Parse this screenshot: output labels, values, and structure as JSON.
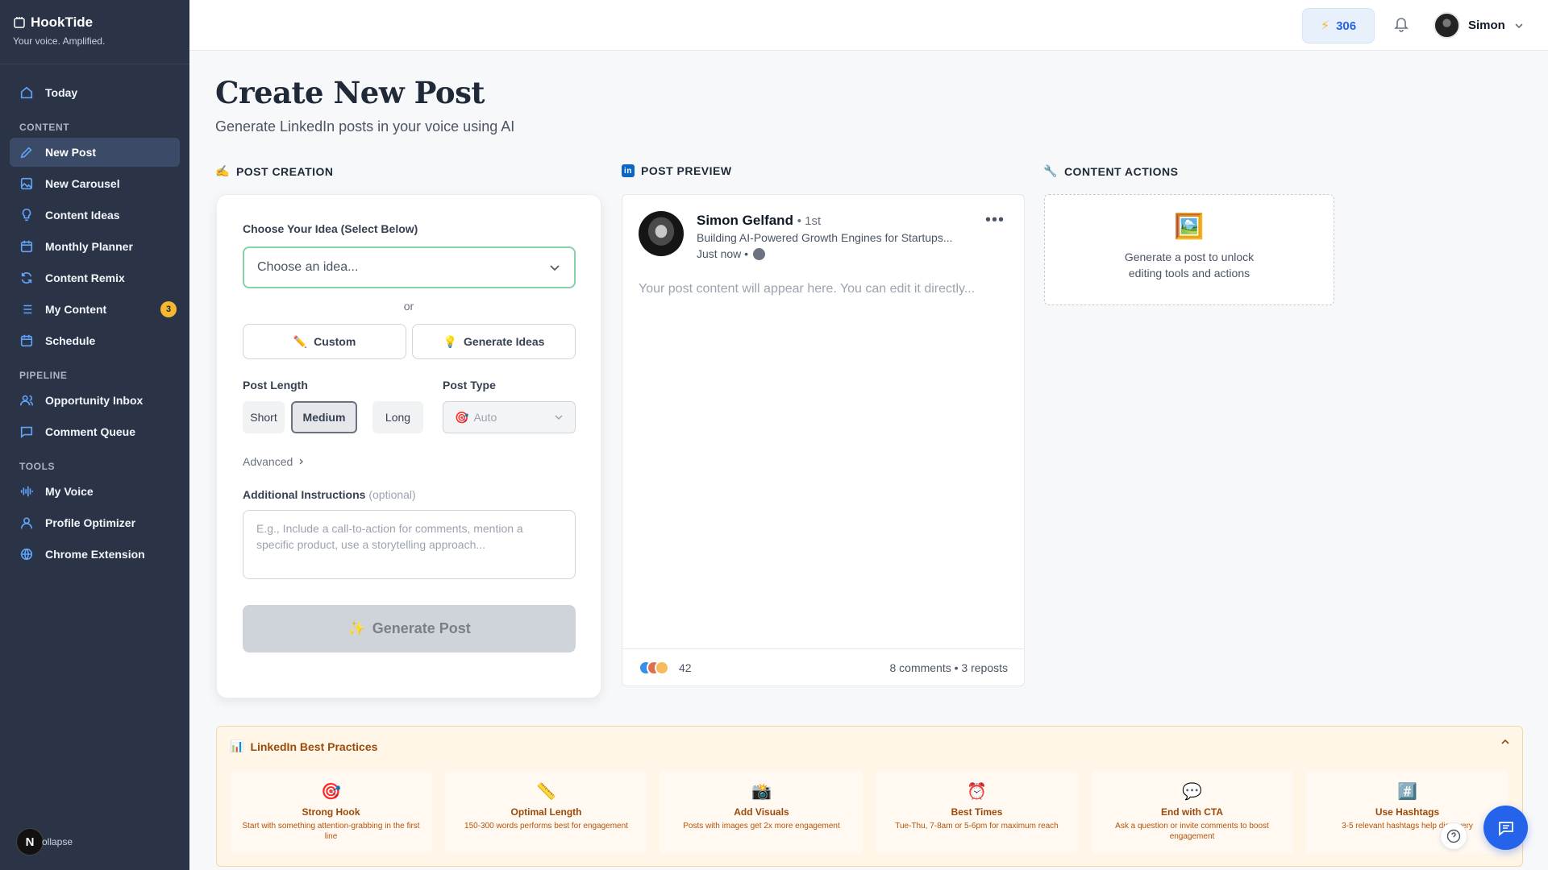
{
  "brand": {
    "name": "HookTide",
    "tagline": "Your voice. Amplified."
  },
  "sidebar": {
    "today": "Today",
    "sections": {
      "content": "CONTENT",
      "pipeline": "PIPELINE",
      "tools": "TOOLS"
    },
    "content_items": [
      {
        "label": "New Post",
        "icon": "pencil-icon",
        "active": true
      },
      {
        "label": "New Carousel",
        "icon": "image-icon"
      },
      {
        "label": "Content Ideas",
        "icon": "lightbulb-icon"
      },
      {
        "label": "Monthly Planner",
        "icon": "calendar-icon"
      },
      {
        "label": "Content Remix",
        "icon": "refresh-icon"
      },
      {
        "label": "My Content",
        "icon": "list-icon",
        "badge": "3"
      },
      {
        "label": "Schedule",
        "icon": "calendar-icon"
      }
    ],
    "pipeline_items": [
      {
        "label": "Opportunity Inbox",
        "icon": "users-icon"
      },
      {
        "label": "Comment Queue",
        "icon": "message-icon"
      }
    ],
    "tools_items": [
      {
        "label": "My Voice",
        "icon": "waveform-icon"
      },
      {
        "label": "Profile Optimizer",
        "icon": "user-icon"
      },
      {
        "label": "Chrome Extension",
        "icon": "globe-icon"
      }
    ],
    "collapse": {
      "avatar": "N",
      "label": "ollapse"
    }
  },
  "topbar": {
    "credits": "306",
    "user_name": "Simon"
  },
  "page": {
    "title": "Create New Post",
    "subtitle": "Generate LinkedIn posts in your voice using AI"
  },
  "sections": {
    "creation": "POST CREATION",
    "preview": "POST PREVIEW",
    "actions": "CONTENT ACTIONS"
  },
  "creation": {
    "idea_label": "Choose Your Idea (Select Below)",
    "idea_placeholder": "Choose an idea...",
    "or": "or",
    "custom_btn": "Custom",
    "generate_ideas_btn": "Generate Ideas",
    "length_label": "Post Length",
    "lengths": [
      "Short",
      "Medium",
      "Long"
    ],
    "selected_length": "Medium",
    "type_label": "Post Type",
    "type_value": "Auto",
    "advanced": "Advanced",
    "instructions_label": "Additional Instructions",
    "instructions_optional": "(optional)",
    "instructions_placeholder": "E.g., Include a call-to-action for comments, mention a specific product, use a storytelling approach...",
    "generate_btn": "Generate Post"
  },
  "preview": {
    "name": "Simon Gelfand",
    "degree": "• 1st",
    "headline": "Building AI-Powered Growth Engines for Startups...",
    "time": "Just now •",
    "more": "•••",
    "body_placeholder": "Your post content will appear here. You can edit it directly...",
    "reactions_count": "42",
    "stats": "8 comments • 3 reposts",
    "reaction_colors": [
      "#378fe9",
      "#df704d",
      "#f5bb5c"
    ]
  },
  "actions": {
    "text_line1": "Generate a post to unlock",
    "text_line2": "editing tools and actions"
  },
  "best_practices": {
    "title": "LinkedIn Best Practices",
    "tips": [
      {
        "icon": "🎯",
        "title": "Strong Hook",
        "desc": "Start with something attention-grabbing in the first line"
      },
      {
        "icon": "📏",
        "title": "Optimal Length",
        "desc": "150-300 words performs best for engagement"
      },
      {
        "icon": "📸",
        "title": "Add Visuals",
        "desc": "Posts with images get 2x more engagement"
      },
      {
        "icon": "⏰",
        "title": "Best Times",
        "desc": "Tue-Thu, 7-8am or 5-6pm for maximum reach"
      },
      {
        "icon": "💬",
        "title": "End with CTA",
        "desc": "Ask a question or invite comments to boost engagement"
      },
      {
        "icon": "#️⃣",
        "title": "Use Hashtags",
        "desc": "3-5 relevant hashtags help discovery"
      }
    ]
  },
  "colors": {
    "sidebar_bg": "#2b3447",
    "accent": "#2563eb",
    "badge": "#f5b82e",
    "best_bg": "#fff6e8"
  }
}
